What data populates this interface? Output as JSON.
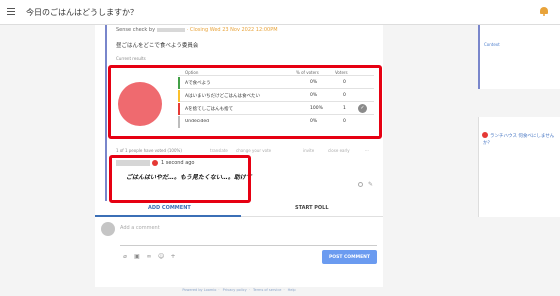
{
  "topbar": {
    "title": "今日のごはんはどうしますか？"
  },
  "poll": {
    "author_prefix": "Sense check by",
    "closing": "· Closing Wed 23 Nov 2022 12:00PM",
    "question": "昼ごはんをどこで食べよう委員会",
    "results_label": "Current results",
    "table": {
      "headers": {
        "option": "Option",
        "pct": "% of voters",
        "votes": "Voters"
      },
      "rows": [
        {
          "option": "Aで食べよう",
          "pct": "0%",
          "votes": "0",
          "color": "#43a047"
        },
        {
          "option": "Aはいまいちだけどごはんは食べたい",
          "pct": "0%",
          "votes": "0",
          "color": "#fbc02d"
        },
        {
          "option": "Aを捨てしごはんも捨て",
          "pct": "100%",
          "votes": "1",
          "color": "#e53935"
        },
        {
          "option": "Undecided",
          "pct": "0%",
          "votes": "0",
          "color": "#bdbdbd"
        }
      ]
    },
    "pie_color": "#ef6a6f",
    "actions": {
      "expire": "1 of 1 people have voted (100%)",
      "translate": "translate",
      "change": "change your vote",
      "invite": "invite",
      "close": "close early",
      "more": "···"
    }
  },
  "comment": {
    "time": "1 second ago",
    "text": "ごはんはいやだ…。もう見たくない…。助けて"
  },
  "tabs": {
    "add_comment": "ADD COMMENT",
    "start_poll": "START POLL"
  },
  "composer": {
    "placeholder": "Add a comment",
    "post": "POST COMMENT"
  },
  "footer": {
    "powered": "Powered by Loomio",
    "privacy": "Privacy policy",
    "terms": "Terms of service",
    "help": "Help"
  },
  "right_pane": {
    "context": "Context",
    "item": "ランチハウス 何食べにしませんか？"
  },
  "colors": {
    "accent": "#3b6fb6",
    "highlight": "#e60012",
    "post_button": "#6b9bf0"
  }
}
